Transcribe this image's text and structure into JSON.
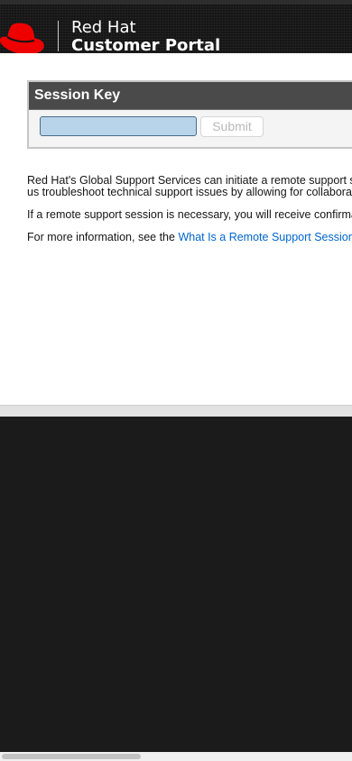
{
  "header": {
    "brand_line1": "Red Hat",
    "brand_line2": "Customer Portal",
    "logo_icon": "red-hat-fedora-icon"
  },
  "session": {
    "title": "Session Key",
    "input_value": "",
    "input_placeholder": "",
    "submit_label": "Submit"
  },
  "body": {
    "para1_line1": "Red Hat's Global Support Services can initiate a remote support session",
    "para1_line2": "us troubleshoot technical support issues by allowing for collaboration",
    "para2": "If a remote support session is necessary, you will receive confirmation",
    "para3_prefix": "For more information, see the ",
    "para3_link": "What Is a Remote Support Session"
  },
  "colors": {
    "brand_red": "#ee0000",
    "link_blue": "#0066cc",
    "header_bg": "#151515",
    "input_bg": "#b8d4ea"
  }
}
